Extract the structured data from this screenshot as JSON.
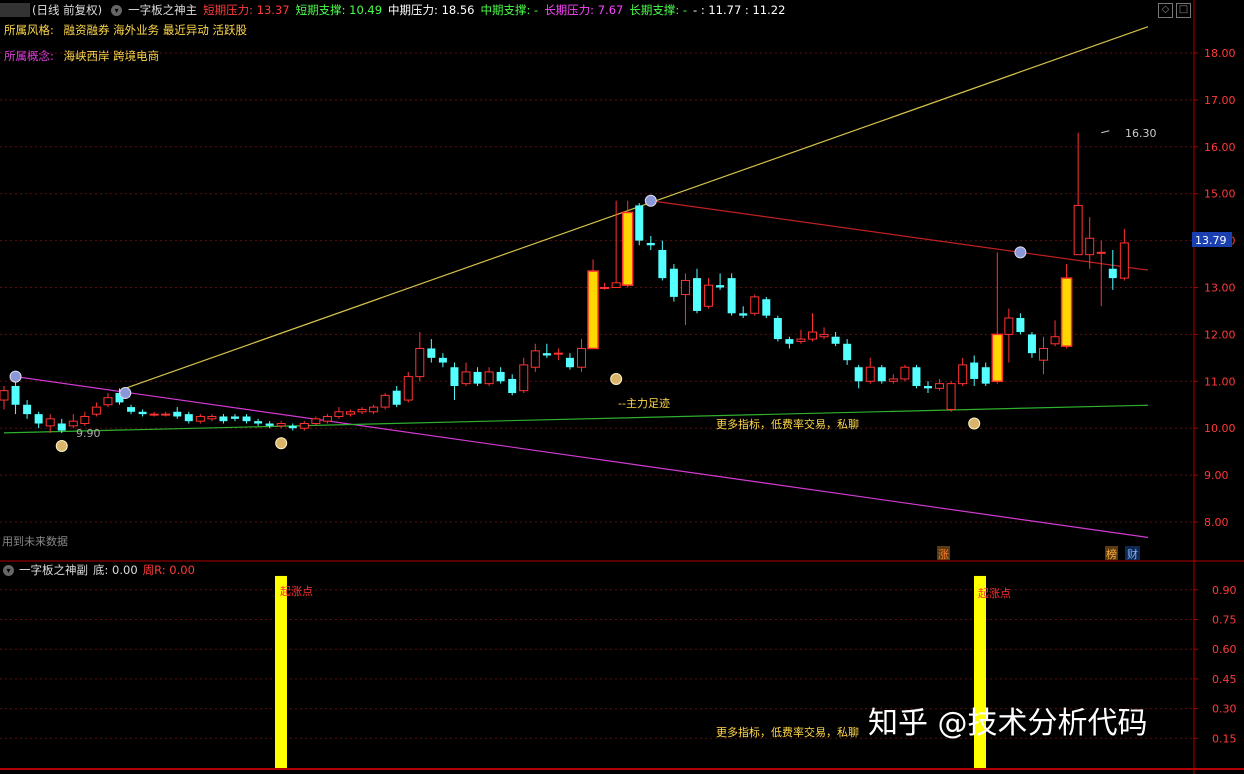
{
  "header": {
    "title_prefix": "(日线 前复权)",
    "indicator_name": "一字板之神主",
    "items": [
      {
        "label": "短期压力: 13.37",
        "color": "#ff3b3b"
      },
      {
        "label": "短期支撑: 10.49",
        "color": "#4cff4c"
      },
      {
        "label": "中期压力: 18.56",
        "color": "#ffffff"
      },
      {
        "label": "中期支撑: -",
        "color": "#4cff4c"
      },
      {
        "label": "长期压力: 7.67",
        "color": "#ff44ff"
      },
      {
        "label": "长期支撑: -",
        "color": "#4cff4c"
      },
      {
        "label": "- : 11.77 : 11.22",
        "color": "#ffffff"
      }
    ]
  },
  "style_row": {
    "label": "所属风格:",
    "values": "融资融券 海外业务 最近异动 活跃股"
  },
  "concept_row": {
    "label": "所属概念:",
    "values": "海峡西岸 跨境电商"
  },
  "future_note": "用到未来数据",
  "annotations": {
    "low_price": "9.90",
    "high_price": "16.30",
    "main_force": "--主力足迹",
    "more_indicators": "更多指标，低费率交易，私聊",
    "current_price": "13.79",
    "badge_1": "涨",
    "badge_2": "榜",
    "badge_3": "财"
  },
  "sub_panel": {
    "name": "一字板之神副",
    "value_label": "底: 0.00",
    "value_label2": "周R: 0.00",
    "bar_label": "起涨点",
    "more_indicators": "更多指标，低费率交易，私聊",
    "watermark": "知乎 @技术分析代码"
  },
  "colors": {
    "up": "#ff3232",
    "down": "#54ffff",
    "limit_up": "#ffd700",
    "axis": "#b00000",
    "gold_line": "#d4c24a",
    "red_line": "#c02020",
    "magenta_line": "#d23ad2",
    "green_line": "#2fb02f"
  },
  "chart_data": [
    {
      "type": "candlestick",
      "ylim": [
        7.6,
        18.75
      ],
      "ticks": [
        8.0,
        9.0,
        10.0,
        11.0,
        12.0,
        13.0,
        14.0,
        15.0,
        16.0,
        17.0,
        18.0
      ],
      "tick_labels": [
        "8.00",
        "9.00",
        "10.00",
        "11.00",
        "12.00",
        "13.00",
        "14.00",
        "15.00",
        "16.00",
        "17.00",
        "18.00"
      ],
      "candles": [
        [
          10.6,
          10.8,
          10.9,
          10.4
        ],
        [
          10.9,
          10.5,
          11.0,
          10.3
        ],
        [
          10.5,
          10.3,
          10.6,
          10.2
        ],
        [
          10.3,
          10.1,
          10.35,
          10.0
        ],
        [
          10.05,
          10.2,
          10.3,
          9.9
        ],
        [
          10.1,
          9.95,
          10.2,
          9.9
        ],
        [
          10.05,
          10.15,
          10.3,
          10.0
        ],
        [
          10.1,
          10.25,
          10.35,
          10.05
        ],
        [
          10.3,
          10.45,
          10.55,
          10.25
        ],
        [
          10.5,
          10.65,
          10.75,
          10.45
        ],
        [
          10.75,
          10.55,
          10.85,
          10.5
        ],
        [
          10.45,
          10.35,
          10.5,
          10.3
        ],
        [
          10.35,
          10.3,
          10.4,
          10.25
        ],
        [
          10.3,
          10.3,
          10.35,
          10.25
        ],
        [
          10.3,
          10.3,
          10.35,
          10.25
        ],
        [
          10.35,
          10.25,
          10.45,
          10.2
        ],
        [
          10.3,
          10.15,
          10.35,
          10.1
        ],
        [
          10.15,
          10.25,
          10.3,
          10.1
        ],
        [
          10.2,
          10.25,
          10.3,
          10.15
        ],
        [
          10.25,
          10.15,
          10.3,
          10.1
        ],
        [
          10.25,
          10.2,
          10.3,
          10.15
        ],
        [
          10.25,
          10.15,
          10.3,
          10.1
        ],
        [
          10.15,
          10.1,
          10.2,
          10.05
        ],
        [
          10.1,
          10.05,
          10.15,
          10.0
        ],
        [
          10.05,
          10.1,
          10.15,
          10.0
        ],
        [
          10.05,
          10.0,
          10.1,
          9.95
        ],
        [
          10.0,
          10.1,
          10.15,
          9.95
        ],
        [
          10.1,
          10.2,
          10.25,
          10.05
        ],
        [
          10.15,
          10.25,
          10.3,
          10.1
        ],
        [
          10.25,
          10.35,
          10.45,
          10.2
        ],
        [
          10.3,
          10.35,
          10.4,
          10.25
        ],
        [
          10.35,
          10.4,
          10.45,
          10.3
        ],
        [
          10.35,
          10.45,
          10.5,
          10.3
        ],
        [
          10.45,
          10.7,
          10.75,
          10.4
        ],
        [
          10.8,
          10.5,
          10.9,
          10.45
        ],
        [
          10.6,
          11.1,
          11.2,
          10.55
        ],
        [
          11.1,
          11.7,
          12.05,
          11.0
        ],
        [
          11.7,
          11.5,
          11.9,
          11.4
        ],
        [
          11.5,
          11.4,
          11.6,
          11.3
        ],
        [
          11.3,
          10.9,
          11.4,
          10.6
        ],
        [
          10.95,
          11.2,
          11.4,
          10.9
        ],
        [
          11.2,
          10.95,
          11.3,
          10.9
        ],
        [
          10.95,
          11.2,
          11.3,
          10.9
        ],
        [
          11.2,
          11.0,
          11.3,
          10.95
        ],
        [
          11.05,
          10.75,
          11.15,
          10.7
        ],
        [
          10.8,
          11.35,
          11.5,
          10.75
        ],
        [
          11.3,
          11.65,
          11.8,
          11.2
        ],
        [
          11.6,
          11.55,
          11.8,
          11.5
        ],
        [
          11.6,
          11.6,
          11.7,
          11.45
        ],
        [
          11.5,
          11.3,
          11.6,
          11.25
        ],
        [
          11.3,
          11.7,
          11.9,
          11.2
        ],
        [
          11.7,
          13.35,
          13.6,
          11.7
        ],
        [
          13.0,
          13.0,
          13.1,
          12.95
        ],
        [
          13.0,
          13.1,
          14.85,
          13.0
        ],
        [
          13.05,
          14.6,
          14.85,
          13.0
        ],
        [
          14.75,
          14.0,
          14.8,
          13.9
        ],
        [
          13.95,
          13.9,
          14.1,
          13.8
        ],
        [
          13.8,
          13.2,
          14.0,
          13.15
        ],
        [
          13.4,
          12.8,
          13.5,
          12.7
        ],
        [
          12.85,
          13.15,
          13.3,
          12.2
        ],
        [
          13.2,
          12.5,
          13.4,
          12.45
        ],
        [
          12.6,
          13.05,
          13.2,
          12.55
        ],
        [
          13.05,
          13.0,
          13.3,
          12.95
        ],
        [
          13.2,
          12.45,
          13.3,
          12.4
        ],
        [
          12.45,
          12.4,
          12.6,
          12.35
        ],
        [
          12.45,
          12.8,
          12.85,
          12.4
        ],
        [
          12.75,
          12.4,
          12.8,
          12.35
        ],
        [
          12.35,
          11.9,
          12.4,
          11.85
        ],
        [
          11.9,
          11.8,
          11.95,
          11.7
        ],
        [
          11.85,
          11.9,
          12.1,
          11.8
        ],
        [
          11.9,
          12.05,
          12.45,
          11.85
        ],
        [
          11.95,
          12.0,
          12.15,
          11.9
        ],
        [
          11.95,
          11.8,
          12.05,
          11.75
        ],
        [
          11.8,
          11.45,
          11.9,
          11.35
        ],
        [
          11.3,
          11.0,
          11.35,
          10.85
        ],
        [
          11.0,
          11.3,
          11.5,
          10.95
        ],
        [
          11.3,
          11.0,
          11.35,
          10.95
        ],
        [
          11.0,
          11.05,
          11.15,
          10.95
        ],
        [
          11.05,
          11.3,
          11.35,
          11.0
        ],
        [
          11.3,
          10.9,
          11.35,
          10.85
        ],
        [
          10.9,
          10.85,
          11.0,
          10.75
        ],
        [
          10.85,
          10.95,
          11.05,
          10.8
        ],
        [
          10.4,
          10.95,
          11.0,
          10.35
        ],
        [
          10.95,
          11.35,
          11.5,
          10.9
        ],
        [
          11.4,
          11.05,
          11.55,
          10.9
        ],
        [
          11.3,
          10.95,
          11.4,
          10.9
        ],
        [
          11.0,
          12.0,
          13.75,
          10.95
        ],
        [
          12.0,
          12.35,
          12.55,
          11.4
        ],
        [
          12.35,
          12.05,
          12.45,
          12.0
        ],
        [
          12.0,
          11.6,
          12.05,
          11.5
        ],
        [
          11.45,
          11.7,
          11.95,
          11.15
        ],
        [
          11.8,
          11.95,
          12.3,
          11.75
        ],
        [
          11.75,
          13.2,
          13.5,
          11.7
        ],
        [
          13.7,
          14.75,
          16.3,
          13.7
        ],
        [
          13.7,
          14.05,
          14.5,
          13.4
        ],
        [
          13.75,
          13.75,
          14.0,
          12.6
        ],
        [
          13.4,
          13.2,
          13.8,
          12.95
        ],
        [
          13.2,
          13.95,
          14.25,
          13.15
        ]
      ]
    },
    {
      "type": "bar",
      "ylim": [
        0,
        1.0
      ],
      "ticks": [
        0.15,
        0.3,
        0.45,
        0.6,
        0.75,
        0.9
      ],
      "tick_labels": [
        "0.15",
        "0.30",
        "0.45",
        "0.60",
        "0.75",
        "0.90"
      ],
      "x": [
        22,
        80
      ],
      "values": [
        1.0,
        1.0
      ]
    }
  ]
}
